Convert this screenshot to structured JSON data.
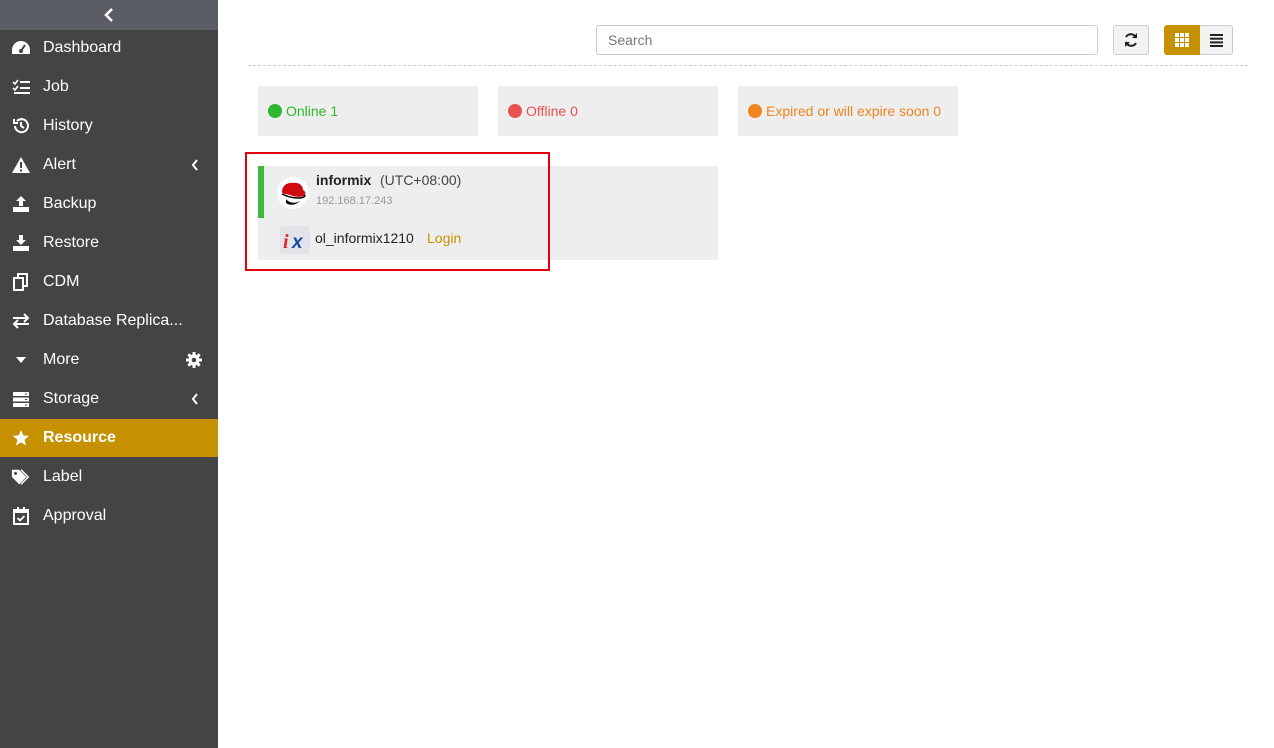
{
  "sidebar": {
    "items": [
      {
        "label": "Dashboard",
        "icon": "dashboard-icon"
      },
      {
        "label": "Job",
        "icon": "job-list-icon"
      },
      {
        "label": "History",
        "icon": "history-icon"
      },
      {
        "label": "Alert",
        "icon": "alert-icon"
      },
      {
        "label": "Backup",
        "icon": "backup-icon"
      },
      {
        "label": "Restore",
        "icon": "restore-icon"
      },
      {
        "label": "CDM",
        "icon": "cdm-icon"
      },
      {
        "label": "Database Replica...",
        "icon": "replication-icon"
      },
      {
        "label": "More",
        "icon": "caret-down-icon"
      },
      {
        "label": "Storage",
        "icon": "storage-icon"
      },
      {
        "label": "Resource",
        "icon": "star-icon",
        "active": true
      },
      {
        "label": "Label",
        "icon": "tags-icon"
      },
      {
        "label": "Approval",
        "icon": "approval-icon"
      }
    ]
  },
  "toolbar": {
    "search_placeholder": "Search"
  },
  "status": {
    "online": "Online 1",
    "offline": "Offline 0",
    "expired": "Expired or will expire soon 0",
    "colors": {
      "online": "#2db82d",
      "offline": "#e85151",
      "expired": "#f0841f"
    }
  },
  "card": {
    "host_name": "informix",
    "timezone": "(UTC+08:00)",
    "ip": "192.168.17.243",
    "db_instance": "ol_informix1210",
    "login_label": "Login"
  },
  "colors": {
    "accent": "#c59100",
    "sidebar": "#444444"
  }
}
